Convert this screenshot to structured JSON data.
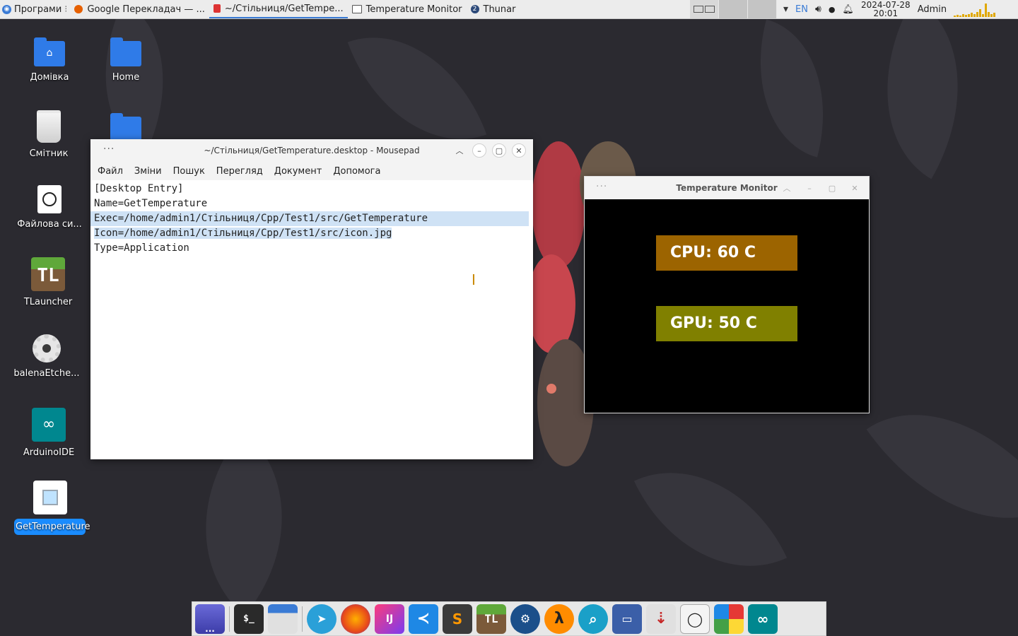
{
  "top_panel": {
    "apps_menu": "Програми",
    "tasks": [
      {
        "label": "Google Перекладач — ...",
        "icon": "firefox-icon"
      },
      {
        "label": "~/Стільниця/GetTempe...",
        "icon": "mousepad-icon",
        "active": true
      },
      {
        "label": "Temperature Monitor",
        "icon": "window-icon"
      },
      {
        "label": "Thunar",
        "icon": "thunar-icon",
        "badge": "2"
      }
    ],
    "lang": "EN",
    "date": "2024-07-28",
    "time": "20:01",
    "user": "Admin",
    "cpu_levels": [
      0.1,
      0.15,
      0.1,
      0.2,
      0.15,
      0.2,
      0.25,
      0.2,
      0.3,
      0.5,
      0.2,
      0.85,
      0.3,
      0.2,
      0.25
    ]
  },
  "desktop": {
    "icons": [
      {
        "label": "Домівка",
        "icon": "home-folder-icon"
      },
      {
        "label": "Home",
        "icon": "folder-icon"
      },
      {
        "label": "Смітник",
        "icon": "trash-icon"
      },
      {
        "label": "Файлова си...",
        "icon": "drive-icon"
      },
      {
        "label": "TLauncher",
        "icon": "tlauncher-icon"
      },
      {
        "label": "balenaEtche...",
        "icon": "gear-icon"
      },
      {
        "label": "ArduinoIDE",
        "icon": "arduino-icon"
      },
      {
        "label": "GetTemperature",
        "icon": "chip-icon",
        "selected": true
      }
    ]
  },
  "mousepad": {
    "title": "~/Стільниця/GetTemperature.desktop - Mousepad",
    "menu": [
      "Файл",
      "Зміни",
      "Пошук",
      "Перегляд",
      "Документ",
      "Допомога"
    ],
    "lines": [
      "[Desktop Entry]",
      "Name=GetTemperature",
      "Exec=/home/admin1/Стільниця/Cpp/Test1/src/GetTemperature",
      "Icon=/home/admin1/Стільниця/Cpp/Test1/src/icon.jpg",
      "Type=Application"
    ]
  },
  "temp_monitor": {
    "title": "Temperature Monitor",
    "cpu": "CPU: 60 C",
    "gpu": "GPU: 50 C",
    "cpu_color": "#9c6400",
    "gpu_color": "#808000"
  },
  "dock": {
    "items": [
      "show-desktop-icon",
      "terminal-icon",
      "files-icon",
      "telegram-icon",
      "firefox-icon",
      "intellij-icon",
      "vscode-icon",
      "sublime-icon",
      "tlauncher-icon",
      "steam-icon",
      "half-life-icon",
      "search-icon",
      "screen-recorder-icon",
      "download-icon",
      "drive-icon",
      "image-viewer-icon",
      "arduino-icon"
    ]
  }
}
